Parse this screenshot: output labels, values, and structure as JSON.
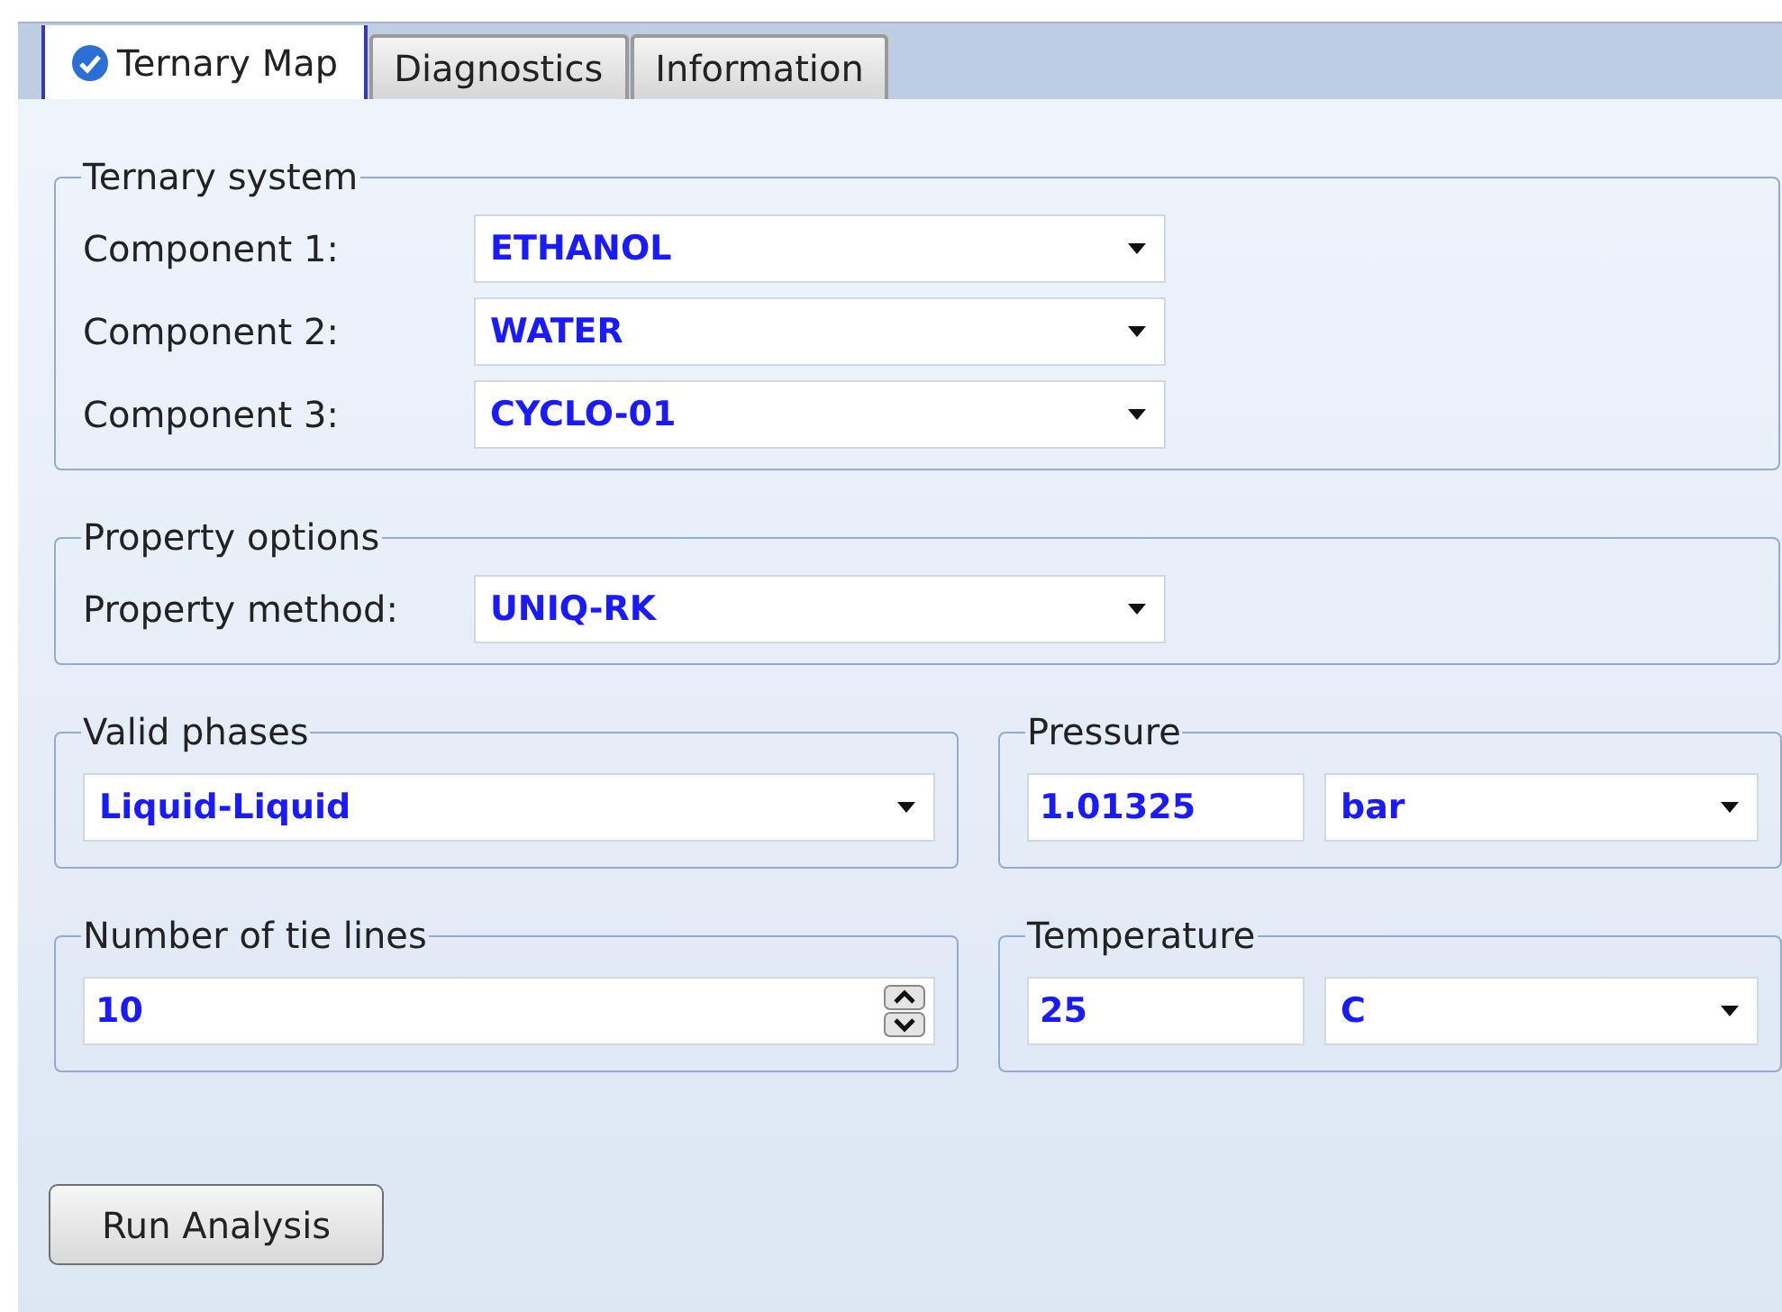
{
  "tabs": [
    {
      "label": "Ternary Map",
      "selected": true,
      "checked": true
    },
    {
      "label": "Diagnostics",
      "selected": false,
      "checked": false
    },
    {
      "label": "Information",
      "selected": false,
      "checked": false
    }
  ],
  "ternary_system": {
    "title": "Ternary system",
    "rows": [
      {
        "label": "Component 1:",
        "value": "ETHANOL"
      },
      {
        "label": "Component 2:",
        "value": "WATER"
      },
      {
        "label": "Component 3:",
        "value": "CYCLO-01"
      }
    ]
  },
  "property_options": {
    "title": "Property options",
    "rows": [
      {
        "label": "Property method:",
        "value": "UNIQ-RK"
      }
    ]
  },
  "valid_phases": {
    "title": "Valid phases",
    "value": "Liquid-Liquid"
  },
  "pressure": {
    "title": "Pressure",
    "value": "1.01325",
    "unit": "bar"
  },
  "tie_lines": {
    "title": "Number of tie lines",
    "value": "10"
  },
  "temperature": {
    "title": "Temperature",
    "value": "25",
    "unit": "C"
  },
  "buttons": [
    "Run Analysis"
  ]
}
